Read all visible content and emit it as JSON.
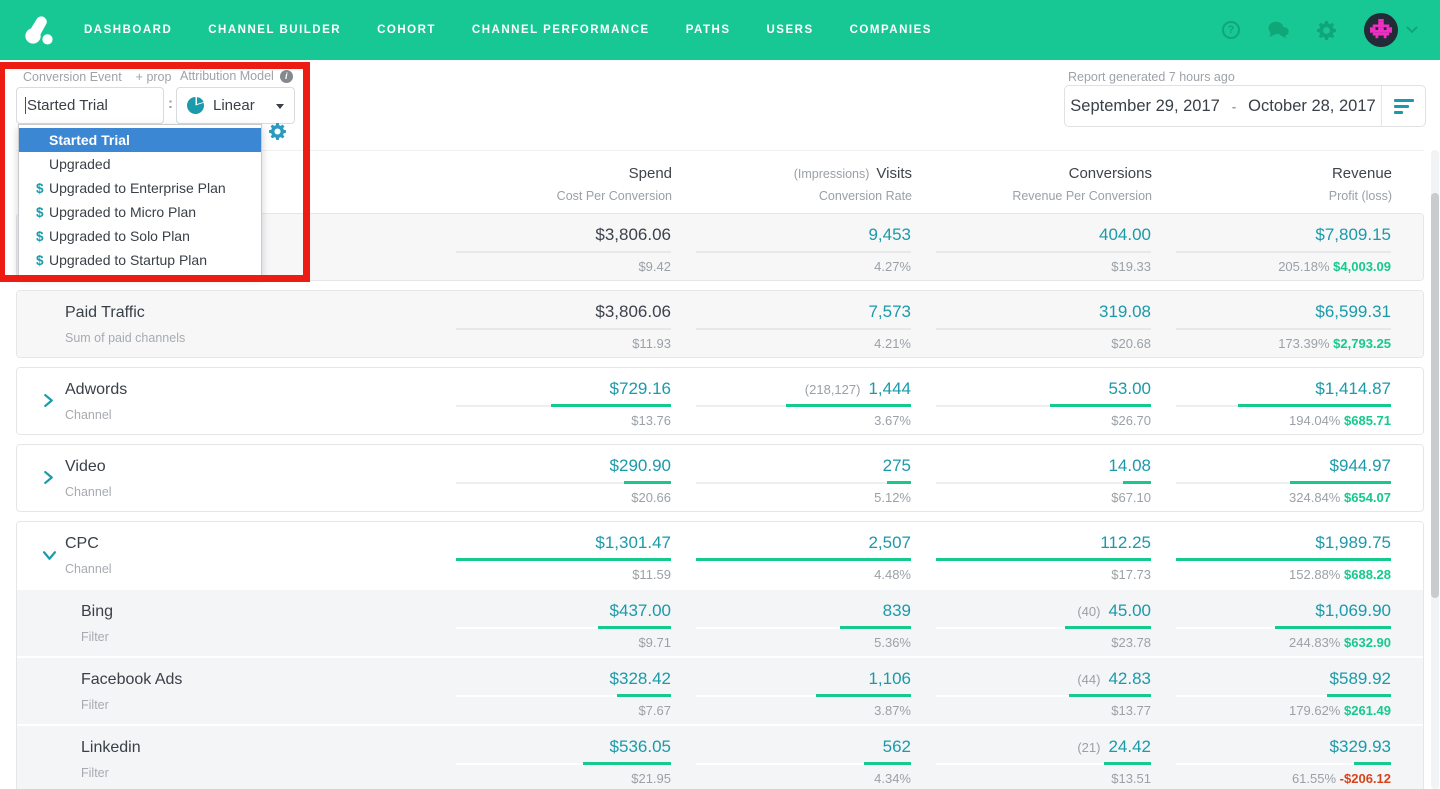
{
  "nav": {
    "items": [
      "DASHBOARD",
      "CHANNEL BUILDER",
      "COHORT",
      "CHANNEL PERFORMANCE",
      "PATHS",
      "USERS",
      "COMPANIES"
    ]
  },
  "icons": {
    "brand": "attribution-logo",
    "help_glyph": "?",
    "messages": "chat-bubbles",
    "settings": "gear",
    "account_caret": "chevron-down",
    "attribution_model": "pie-chart",
    "info_glyph": "i",
    "money_glyph": "$",
    "report_filter": "align-left-bars",
    "row_expand": "chevron-right",
    "row_expanded": "chevron-down"
  },
  "filters": {
    "conversion_event_label": "Conversion Event",
    "prop_label": "+ prop",
    "conversion_event_value": "Started Trial",
    "colon": ":",
    "colon2": ":",
    "attribution_label": "Attribution Model",
    "attribution_value": "Linear",
    "dropdown_items": [
      {
        "label": "Started Trial",
        "selected": true,
        "money": false
      },
      {
        "label": "Upgraded",
        "selected": false,
        "money": false
      },
      {
        "label": "Upgraded to Enterprise Plan",
        "selected": false,
        "money": true
      },
      {
        "label": "Upgraded to Micro Plan",
        "selected": false,
        "money": true
      },
      {
        "label": "Upgraded to Solo Plan",
        "selected": false,
        "money": true
      },
      {
        "label": "Upgraded to Startup Plan",
        "selected": false,
        "money": true
      }
    ]
  },
  "report": {
    "generated_label": "Report generated 7 hours ago",
    "date_start": "September 29, 2017",
    "date_separator": "-",
    "date_end": "October 28, 2017"
  },
  "colors": {
    "nav_green": "#17c794",
    "teal_link": "#1a9aaa",
    "profit_green": "#16c98d",
    "loss_red": "#d8431c",
    "selected_blue": "#3c87d3",
    "annotation_red": "#ec1c13"
  },
  "table": {
    "columns": [
      {
        "pre": "",
        "main": "Spend",
        "sub": "Cost Per Conversion"
      },
      {
        "pre": "(Impressions)",
        "main": "Visits",
        "sub": "Conversion Rate"
      },
      {
        "pre": "",
        "main": "Conversions",
        "sub": "Revenue Per Conversion"
      },
      {
        "pre": "",
        "main": "Revenue",
        "sub": "Profit (loss)"
      }
    ],
    "rows": [
      {
        "name": "",
        "subtitle": "",
        "kind": "summary",
        "chevron": "none",
        "spend": {
          "main": "$3,806.06",
          "sub": "$9.42",
          "bar_pct": 0
        },
        "visits": {
          "pre": "",
          "main": "9,453",
          "sub": "4.27%",
          "bar_pct": 0
        },
        "conversions": {
          "pre": "",
          "main": "404.00",
          "sub": "$19.33",
          "bar_pct": 0
        },
        "revenue": {
          "main": "$7,809.15",
          "pct": "205.18%",
          "profit": "$4,003.09",
          "negative": false,
          "bar_pct": 0
        }
      },
      {
        "name": "Paid Traffic",
        "subtitle": "Sum of paid channels",
        "kind": "summary",
        "chevron": "none",
        "spend": {
          "main": "$3,806.06",
          "sub": "$11.93",
          "bar_pct": 0
        },
        "visits": {
          "pre": "",
          "main": "7,573",
          "sub": "4.21%",
          "bar_pct": 0
        },
        "conversions": {
          "pre": "",
          "main": "319.08",
          "sub": "$20.68",
          "bar_pct": 0
        },
        "revenue": {
          "main": "$6,599.31",
          "pct": "173.39%",
          "profit": "$2,793.25",
          "negative": false,
          "bar_pct": 0
        }
      },
      {
        "name": "Adwords",
        "subtitle": "Channel",
        "kind": "channel",
        "chevron": "right",
        "spend": {
          "main": "$729.16",
          "sub": "$13.76",
          "bar_pct": 56
        },
        "visits": {
          "pre": "(218,127)",
          "main": "1,444",
          "sub": "3.67%",
          "bar_pct": 58
        },
        "conversions": {
          "pre": "",
          "main": "53.00",
          "sub": "$26.70",
          "bar_pct": 47
        },
        "revenue": {
          "main": "$1,414.87",
          "pct": "194.04%",
          "profit": "$685.71",
          "negative": false,
          "bar_pct": 71
        }
      },
      {
        "name": "Video",
        "subtitle": "Channel",
        "kind": "channel",
        "chevron": "right",
        "spend": {
          "main": "$290.90",
          "sub": "$20.66",
          "bar_pct": 22
        },
        "visits": {
          "pre": "",
          "main": "275",
          "sub": "5.12%",
          "bar_pct": 11
        },
        "conversions": {
          "pre": "",
          "main": "14.08",
          "sub": "$67.10",
          "bar_pct": 13
        },
        "revenue": {
          "main": "$944.97",
          "pct": "324.84%",
          "profit": "$654.07",
          "negative": false,
          "bar_pct": 47
        }
      },
      {
        "name": "CPC",
        "subtitle": "Channel",
        "kind": "channel",
        "chevron": "down",
        "spend": {
          "main": "$1,301.47",
          "sub": "$11.59",
          "bar_pct": 100
        },
        "visits": {
          "pre": "",
          "main": "2,507",
          "sub": "4.48%",
          "bar_pct": 100
        },
        "conversions": {
          "pre": "",
          "main": "112.25",
          "sub": "$17.73",
          "bar_pct": 100
        },
        "revenue": {
          "main": "$1,989.75",
          "pct": "152.88%",
          "profit": "$688.28",
          "negative": false,
          "bar_pct": 100
        }
      },
      {
        "name": "Bing",
        "subtitle": "Filter",
        "kind": "filter",
        "chevron": "none",
        "spend": {
          "main": "$437.00",
          "sub": "$9.71",
          "bar_pct": 34
        },
        "visits": {
          "pre": "",
          "main": "839",
          "sub": "5.36%",
          "bar_pct": 33
        },
        "conversions": {
          "pre": "(40)",
          "main": "45.00",
          "sub": "$23.78",
          "bar_pct": 40
        },
        "revenue": {
          "main": "$1,069.90",
          "pct": "244.83%",
          "profit": "$632.90",
          "negative": false,
          "bar_pct": 54
        }
      },
      {
        "name": "Facebook Ads",
        "subtitle": "Filter",
        "kind": "filter",
        "chevron": "none",
        "spend": {
          "main": "$328.42",
          "sub": "$7.67",
          "bar_pct": 25
        },
        "visits": {
          "pre": "",
          "main": "1,106",
          "sub": "3.87%",
          "bar_pct": 44
        },
        "conversions": {
          "pre": "(44)",
          "main": "42.83",
          "sub": "$13.77",
          "bar_pct": 38
        },
        "revenue": {
          "main": "$589.92",
          "pct": "179.62%",
          "profit": "$261.49",
          "negative": false,
          "bar_pct": 30
        }
      },
      {
        "name": "Linkedin",
        "subtitle": "Filter",
        "kind": "filter",
        "chevron": "none",
        "spend": {
          "main": "$536.05",
          "sub": "$21.95",
          "bar_pct": 41
        },
        "visits": {
          "pre": "",
          "main": "562",
          "sub": "4.34%",
          "bar_pct": 22
        },
        "conversions": {
          "pre": "(21)",
          "main": "24.42",
          "sub": "$13.51",
          "bar_pct": 22
        },
        "revenue": {
          "main": "$329.93",
          "pct": "61.55%",
          "profit": "-$206.12",
          "negative": true,
          "bar_pct": 17
        }
      }
    ]
  }
}
